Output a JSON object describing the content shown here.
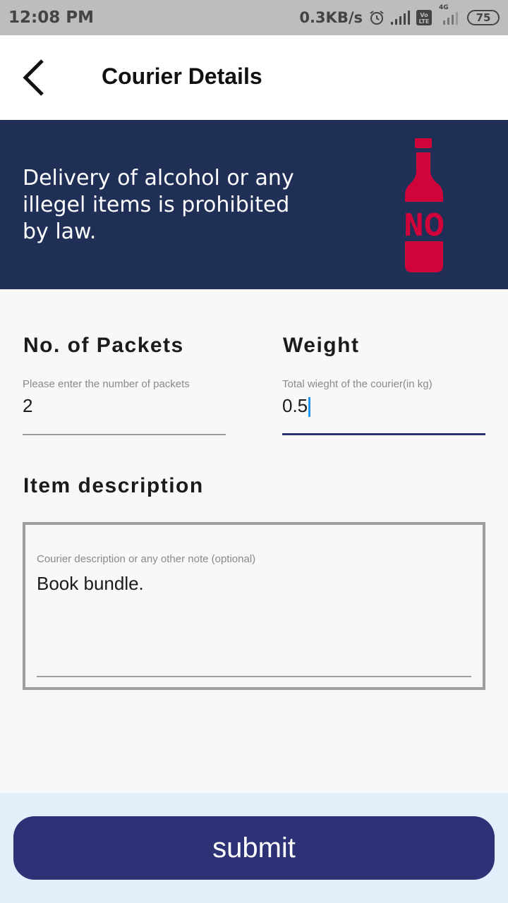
{
  "status_bar": {
    "time": "12:08 PM",
    "network_speed": "0.3KB/s",
    "volte_label": "Vo LTE",
    "network_type": "4G",
    "battery": "75",
    "icons": [
      "alarm-icon",
      "signal-icon",
      "volte-icon",
      "signal-4g-icon",
      "battery-icon"
    ]
  },
  "app_bar": {
    "title": "Courier Details",
    "back_icon": "chevron-left-icon"
  },
  "banner": {
    "notice": "Delivery of alcohol or any illegel items is prohibited by law.",
    "bottle_label": "NO",
    "background_color": "#1f2f56",
    "bottle_color": "#d0043a"
  },
  "form": {
    "packets": {
      "label": "No. of Packets",
      "hint": "Please enter the number of packets",
      "value": "2"
    },
    "weight": {
      "label": "Weight",
      "hint": "Total wieght of the courier(in kg)",
      "value": "0.5"
    },
    "description": {
      "label": "Item description",
      "hint": "Courier description or any other note (optional)",
      "value": "Book bundle."
    }
  },
  "submit": {
    "label": "submit",
    "color": "#2d3175"
  }
}
